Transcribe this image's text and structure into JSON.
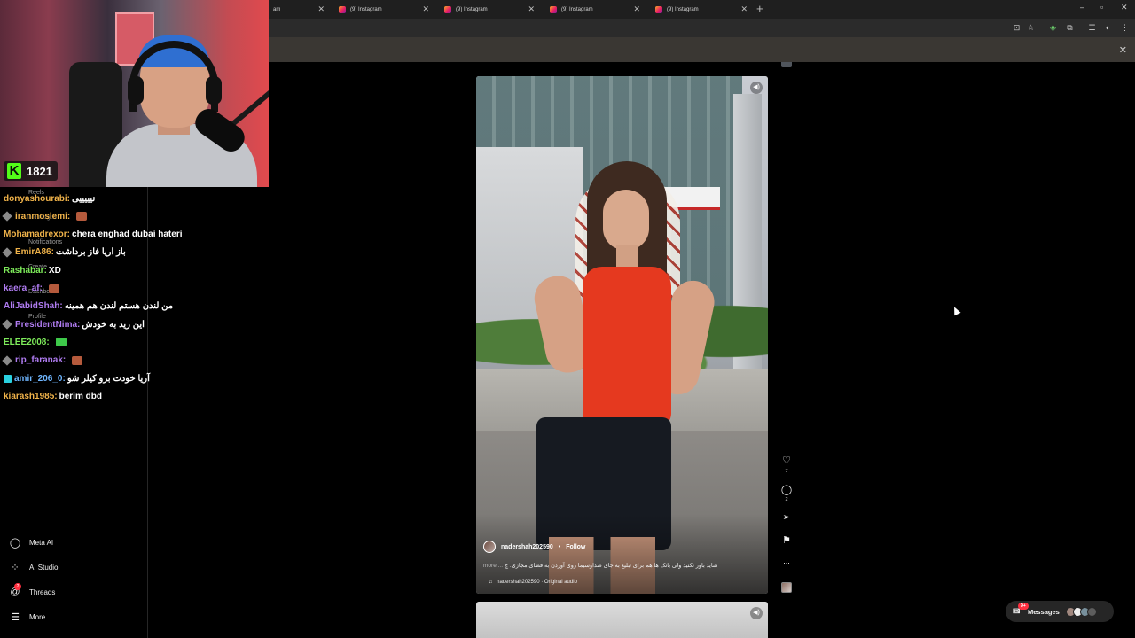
{
  "browser": {
    "tabs": [
      {
        "title": "am"
      },
      {
        "title": "(9) Instagram"
      },
      {
        "title": "(9) Instagram"
      },
      {
        "title": "(9) Instagram"
      },
      {
        "title": "(9) Instagram"
      }
    ],
    "new_tab": "+",
    "window_controls": {
      "minimize": "–",
      "restore": "▫",
      "close": "✕"
    }
  },
  "sidebar": {
    "ghost_items": [
      "Reels",
      "Messages",
      "Notifications",
      "Create",
      "Dashboard",
      "Profile"
    ],
    "items": [
      {
        "label": "Meta AI",
        "icon": "meta-ai-icon"
      },
      {
        "label": "AI Studio",
        "icon": "ai-studio-icon"
      },
      {
        "label": "Threads",
        "icon": "threads-icon",
        "badge": "2"
      },
      {
        "label": "More",
        "icon": "menu-icon"
      }
    ]
  },
  "reel": {
    "username": "nadershah202590",
    "separator": "•",
    "follow_label": "Follow",
    "caption_more": "more ...",
    "caption": "شاید باور نکنید ولی بانک ها هم برای تبلیغ به جای صداوسیما روی آوردن به فضای مجازی. چ",
    "audio_note": "♫",
    "audio": "nadershah202590 · Original audio"
  },
  "actions": {
    "like_count": "7",
    "comment_count": "2",
    "more": "..."
  },
  "messages": {
    "label": "Messages",
    "badge": "9+"
  },
  "stream": {
    "viewer_count": "1821",
    "platform_letter": "K",
    "chat": [
      {
        "user": "donyashourabi:",
        "msg": "نیییییی",
        "color": "#f0b34a",
        "badge": "none"
      },
      {
        "user": "iranmoslemi:",
        "msg": "",
        "color": "#f0b34a",
        "badge": "diamond",
        "emote": "#b55a3c"
      },
      {
        "user": "Mohamadrexor:",
        "msg": "chera enghad dubai hateri",
        "color": "#f0b34a",
        "badge": "none"
      },
      {
        "user": "EmirA86:",
        "msg": "باز اریا فاز برداشت",
        "color": "#f0b34a",
        "badge": "diamond"
      },
      {
        "user": "Rashabar:",
        "msg": "XD",
        "color": "#7dea5a",
        "badge": "none"
      },
      {
        "user": "kaera_af:",
        "msg": "",
        "color": "#b07cf2",
        "badge": "none",
        "emote": "#b55a3c"
      },
      {
        "user": "AliJabidShah:",
        "msg": "من لندن هستم لندن هم همینه",
        "color": "#b07cf2",
        "badge": "none"
      },
      {
        "user": "PresidentNima:",
        "msg": "این رید به خودش",
        "color": "#b07cf2",
        "badge": "diamond"
      },
      {
        "user": "ELEE2008:",
        "msg": "",
        "color": "#7dea5a",
        "badge": "none",
        "emote": "#3ec94a"
      },
      {
        "user": "rip_faranak:",
        "msg": "",
        "color": "#b07cf2",
        "badge": "diamond",
        "emote": "#b55a3c"
      },
      {
        "user": "amir_206_0:",
        "msg": "آریا خودت برو کیلر شو",
        "color": "#6fb6ff",
        "badge": "sub"
      },
      {
        "user": "kiarash1985:",
        "msg": "berim dbd",
        "color": "#f0b34a",
        "badge": "none"
      }
    ]
  }
}
